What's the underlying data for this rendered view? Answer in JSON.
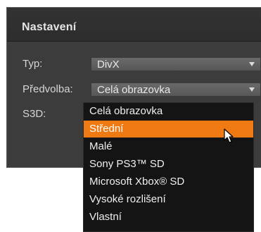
{
  "panel": {
    "title": "Nastavení"
  },
  "fields": [
    {
      "label": "Typ:",
      "value": "DivX"
    },
    {
      "label": "Předvolba:",
      "value": "Celá obrazovka"
    },
    {
      "label": "S3D:",
      "value": ""
    }
  ],
  "dropdown": {
    "options": [
      {
        "label": "Celá obrazovka"
      },
      {
        "label": "Střední"
      },
      {
        "label": "Malé"
      },
      {
        "label": "Sony PS3™ SD"
      },
      {
        "label": "Microsoft Xbox® SD"
      },
      {
        "label": "Vysoké rozlišení"
      },
      {
        "label": "Vlastní"
      }
    ],
    "highlighted_index": 1
  },
  "icons": [
    "chevron-down-icon",
    "mouse-pointer-icon"
  ],
  "colors": {
    "panel_background": "#3c3c3c",
    "header_background": "#2d2d2d",
    "highlight": "#ef7a14",
    "dropdown_background": "#141414"
  }
}
